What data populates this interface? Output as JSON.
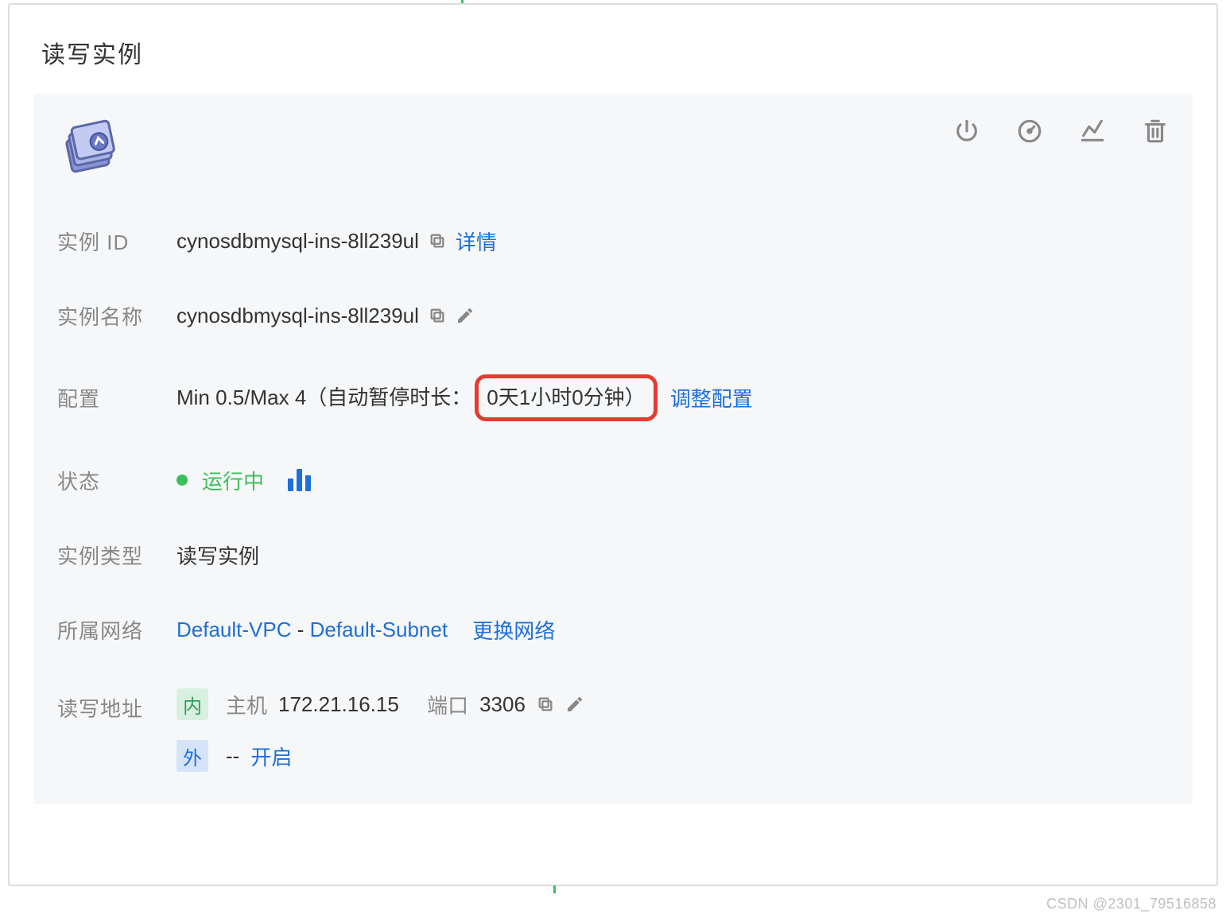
{
  "panel": {
    "title": "读写实例"
  },
  "actions": {
    "power": "power-icon",
    "refresh": "refresh-icon",
    "chart": "chart-icon",
    "delete": "delete-icon"
  },
  "fields": {
    "instance_id": {
      "label": "实例 ID",
      "value": "cynosdbmysql-ins-8ll239ul",
      "detail_link": "详情"
    },
    "instance_name": {
      "label": "实例名称",
      "value": "cynosdbmysql-ins-8ll239ul"
    },
    "config": {
      "label": "配置",
      "prefix": "Min 0.5/Max 4（自动暂停时长：",
      "highlight": "0天1小时0分钟）",
      "adjust_link": "调整配置"
    },
    "status": {
      "label": "状态",
      "value": "运行中"
    },
    "instance_type": {
      "label": "实例类型",
      "value": "读写实例"
    },
    "network": {
      "label": "所属网络",
      "vpc": "Default-VPC",
      "sep": " - ",
      "subnet": "Default-Subnet",
      "change_link": "更换网络"
    },
    "address": {
      "label": "读写地址",
      "internal": {
        "badge": "内",
        "host_label": "主机",
        "host": "172.21.16.15",
        "port_label": "端口",
        "port": "3306"
      },
      "external": {
        "badge": "外",
        "value": "--",
        "enable_link": "开启"
      }
    }
  },
  "watermark": "CSDN @2301_79516858"
}
